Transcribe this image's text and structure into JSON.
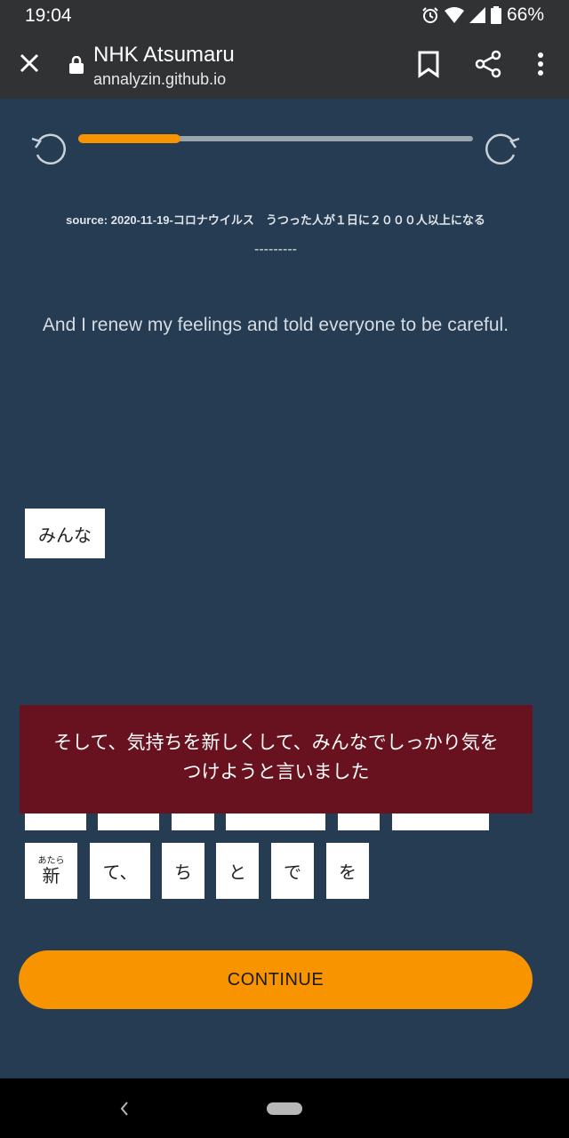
{
  "status": {
    "time": "19:04",
    "battery": "66%"
  },
  "browser": {
    "title": "NHK Atsumaru",
    "url": "annalyzin.github.io"
  },
  "progress": {
    "fraction": 0.26
  },
  "source_line": "source: 2020-11-19-コロナウイルス　うつった人が１日に２０００人以上になる",
  "separator": "---------",
  "translation": "And I renew my feelings and told everyone to be careful.",
  "placed_tiles": [
    "みんな"
  ],
  "hint": {
    "line1": "そして、気持ちを新しくして、みんなでしっかり気を",
    "line2": "つけようと言いました"
  },
  "tiles": [
    {
      "text": "新",
      "ruby": "あたら"
    },
    {
      "text": "て、"
    },
    {
      "text": "ち"
    },
    {
      "text": "と"
    },
    {
      "text": "で"
    },
    {
      "text": "を"
    }
  ],
  "continue_label": "CONTINUE",
  "colors": {
    "accent": "#f79400",
    "background": "#253c52",
    "hint": "#681220"
  }
}
